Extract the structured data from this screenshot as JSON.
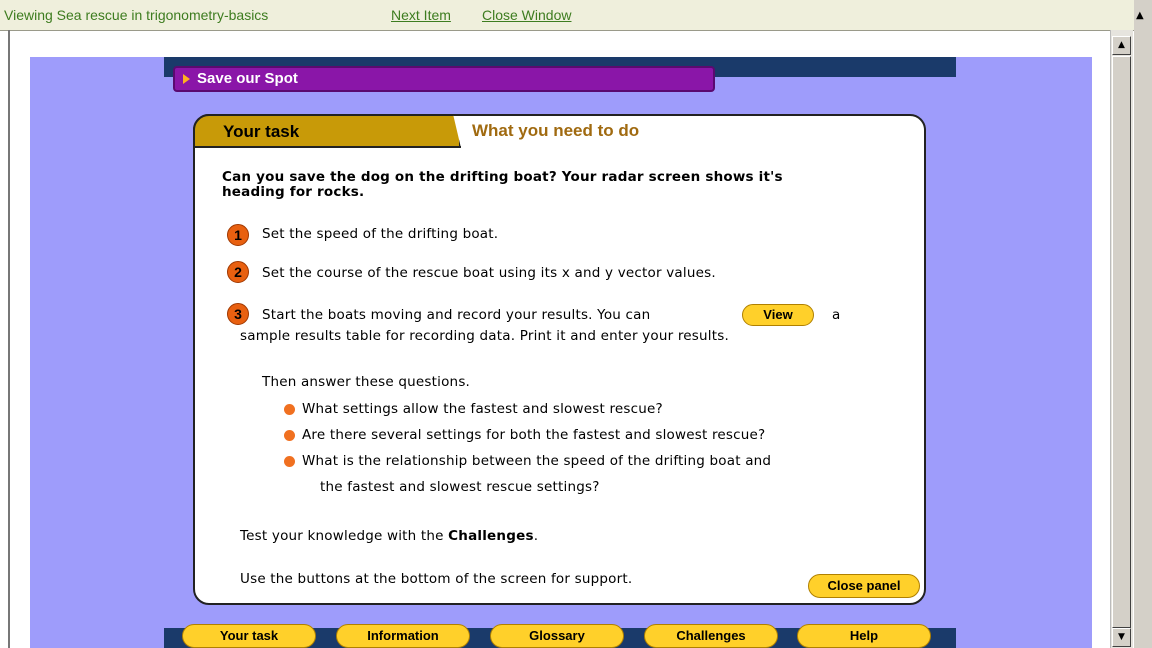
{
  "topbar": {
    "viewing_text": "Viewing Sea rescue in trigonometry-basics",
    "next_item": "Next Item",
    "close_window": "Close Window"
  },
  "header": {
    "title": "Save our Spot"
  },
  "tabs": {
    "active": "Your task",
    "inactive": "What you need to do"
  },
  "task": {
    "intro_line1": "Can you save the dog on the drifting boat? Your radar screen shows it's",
    "intro_line2": "heading for rocks.",
    "steps": [
      {
        "number": "1",
        "text": "Set the speed of the drifting boat."
      },
      {
        "number": "2",
        "text": "Set the course of the rescue boat using its x and y vector values."
      },
      {
        "number": "3",
        "text_before": "Start the boats moving and record your results. You can",
        "text_after": "a",
        "text_line2": "sample results table for recording data. Print it and enter your results."
      }
    ],
    "view_button": "View",
    "questions_intro": "Then answer these questions.",
    "questions": [
      "What settings allow the fastest and slowest rescue?",
      "Are there several settings for both the fastest and slowest rescue?",
      "What is the relationship between the speed of the drifting boat and"
    ],
    "question3_line2": "the fastest and slowest rescue settings?",
    "challenges_text_before": "Test your knowledge with the ",
    "challenges_text_bold": "Challenges",
    "challenges_text_after": ".",
    "support_text": "Use the buttons at the bottom of the screen for support.",
    "close_panel": "Close panel"
  },
  "nav": {
    "buttons": [
      "Your task",
      "Information",
      "Glossary",
      "Challenges",
      "Help"
    ]
  },
  "colors": {
    "stage": "#9e9cfb",
    "header_purple": "#8a16a8",
    "tab_gold": "#c89a08",
    "button_yellow": "#ffd02a",
    "step_orange": "#e86010",
    "navy": "#1a3a6a"
  },
  "icons": {
    "header_arrow": "triangle-right-icon",
    "bullet": "orange-dot-icon",
    "scroll_up": "arrow-up-icon",
    "scroll_down": "arrow-down-icon"
  }
}
